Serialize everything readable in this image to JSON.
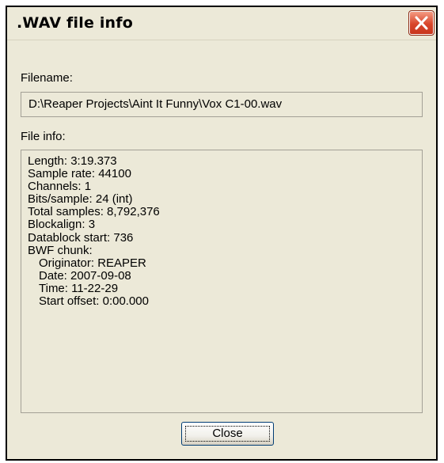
{
  "window": {
    "title": ".WAV file info",
    "close_icon": "close-x-icon"
  },
  "filename": {
    "label": "Filename:",
    "value": "D:\\Reaper Projects\\Aint It Funny\\Vox C1-00.wav"
  },
  "file_info": {
    "label": "File info:",
    "lines": [
      "Length: 3:19.373",
      "Sample rate: 44100",
      "Channels: 1",
      "Bits/sample: 24 (int)",
      "Total samples: 8,792,376",
      "Blockalign: 3",
      "Datablock start: 736",
      "BWF chunk:",
      "Originator: REAPER",
      "Date: 2007-09-08",
      "Time: 11-22-29",
      "Start offset: 0:00.000"
    ]
  },
  "buttons": {
    "close_label": "Close"
  },
  "colors": {
    "dialog_bg": "#ece9d8",
    "close_x_red": "#d8452a",
    "button_border": "#003c74"
  }
}
